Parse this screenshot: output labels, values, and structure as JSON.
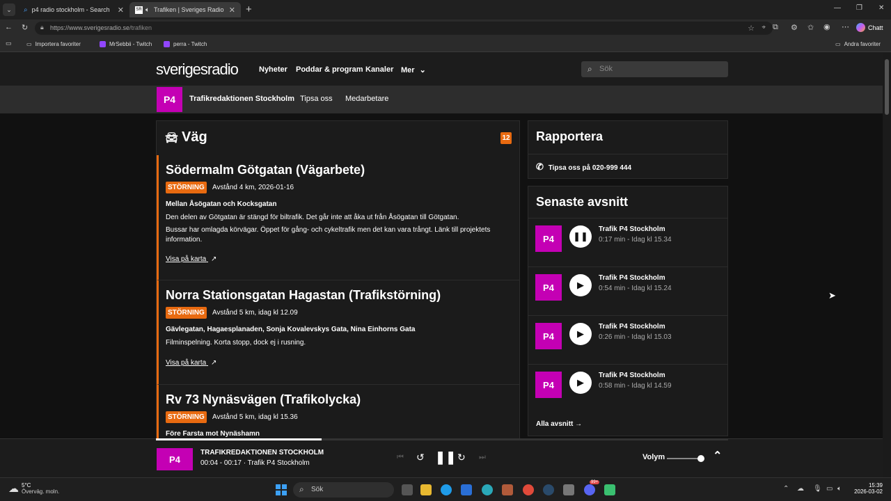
{
  "browser": {
    "tabs": [
      {
        "title": "p4 radio stockholm - Search",
        "active": false
      },
      {
        "title": "Trafiken | Sveriges Radio",
        "active": true
      }
    ],
    "url": "https://www.sverigesradio.se/trafiken",
    "url_host": "https://www.sverigesradio.se",
    "url_path": "/trafiken",
    "chat_label": "Chatt",
    "favorites": [
      "Importera favoriter",
      "MrSebbii - Twitch",
      "perra - Twitch"
    ],
    "other_favorites": "Andra favoriter"
  },
  "site": {
    "logo": "sverigesradio",
    "nav": [
      "Nyheter",
      "Poddar & program",
      "Kanaler",
      "Mer"
    ],
    "search_placeholder": "Sök",
    "sub_title": "Trafikredaktionen Stockholm",
    "sub_links": [
      "Tipsa oss",
      "Medarbetare"
    ],
    "p4_logo": "P4"
  },
  "vag": {
    "title": "Väg",
    "count": "12",
    "items": [
      {
        "title": "Södermalm Götgatan (Vägarbete)",
        "badge": "STÖRNING",
        "meta": "Avstånd 4 km, 2026-01-16",
        "location": "Mellan Åsögatan och Kocksgatan",
        "desc1": "Den delen av Götgatan är stängd för biltrafik. Det går inte att åka ut från Åsögatan till Götgatan.",
        "desc2": "Bussar har omlagda körvägar. Öppet för gång- och cykeltrafik men det kan vara trångt. Länk till projektets information.",
        "link": "Visa på karta"
      },
      {
        "title": "Norra Stationsgatan Hagastan (Trafikstörning)",
        "badge": "STÖRNING",
        "meta": "Avstånd 5 km, idag kl 12.09",
        "location": "Gävlegatan, Hagaesplanaden, Sonja Kovalevskys Gata, Nina Einhorns Gata",
        "desc1": "Filminspelning. Korta stopp, dock ej i rusning.",
        "link": "Visa på karta"
      },
      {
        "title": "Rv 73 Nynäsvägen (Trafikolycka)",
        "badge": "STÖRNING",
        "meta": "Avstånd 5 km, idag kl 15.36",
        "location": "Före Farsta mot Nynäshamn"
      }
    ]
  },
  "rapportera": {
    "title": "Rapportera",
    "phone": "Tipsa oss på 020-999 444"
  },
  "episodes": {
    "title": "Senaste avsnitt",
    "items": [
      {
        "title": "Trafik P4 Stockholm",
        "meta": "0:17 min  -  Idag kl 15.34",
        "playing": true
      },
      {
        "title": "Trafik P4 Stockholm",
        "meta": "0:54 min  -  Idag kl 15.24",
        "playing": false
      },
      {
        "title": "Trafik P4 Stockholm",
        "meta": "0:26 min  -  Idag kl 15.03",
        "playing": false
      },
      {
        "title": "Trafik P4 Stockholm",
        "meta": "0:58 min  -  Idag kl 14.59",
        "playing": false
      }
    ],
    "all_link": "Alla avsnitt →"
  },
  "player": {
    "title": "TRAFIKREDAKTIONEN STOCKHOLM",
    "sub": "00:04 - 00:17 · Trafik P4 Stockholm",
    "progress": 0.29,
    "volume_label": "Volym",
    "volume": 0.9
  },
  "taskbar": {
    "weather_temp": "5°C",
    "weather_desc": "Övervāg. moln.",
    "search": "Sök",
    "time": "15:39",
    "date": "2026-03-02",
    "badge": "99+"
  },
  "colors": {
    "accent": "#e86a10",
    "p4": "#c400b4"
  }
}
